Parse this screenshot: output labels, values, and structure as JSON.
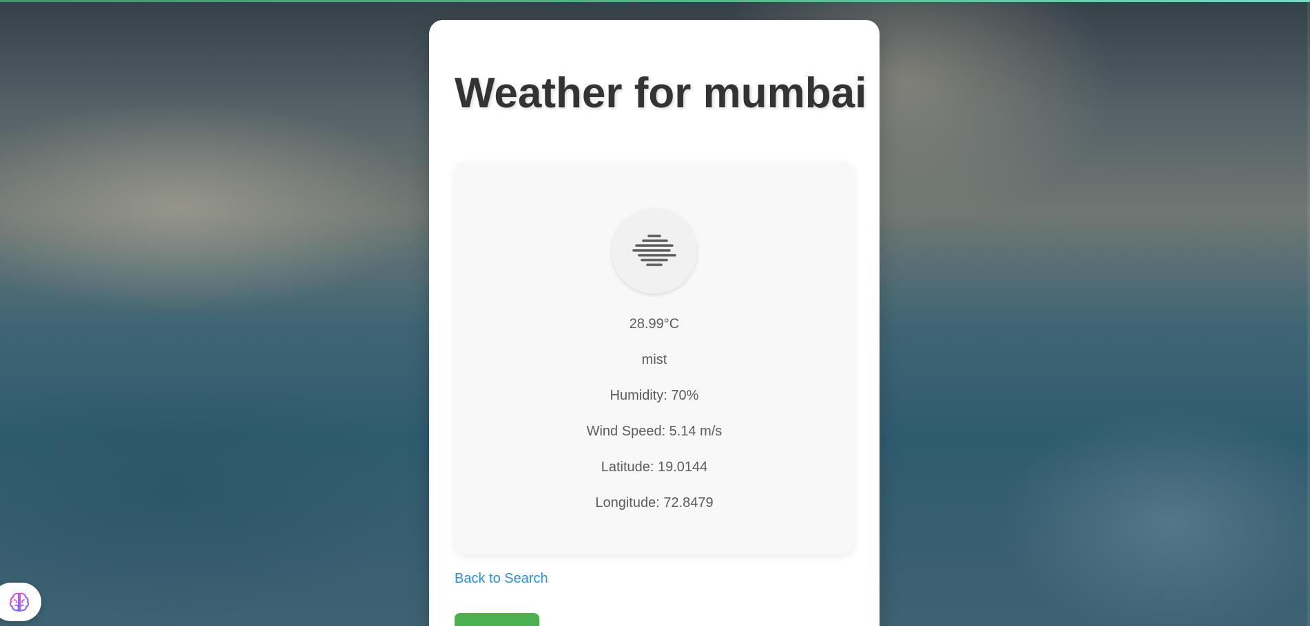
{
  "page": {
    "title": "Weather for mumbai"
  },
  "weather": {
    "icon": "mist-icon",
    "temperature": "28.99°C",
    "description": "mist",
    "humidity": "Humidity: 70%",
    "wind_speed": "Wind Speed: 5.14 m/s",
    "latitude": "Latitude: 19.0144",
    "longitude": "Longitude: 72.8479"
  },
  "links": {
    "back_to_search": "Back to Search"
  },
  "buttons": {
    "green_button_label": ""
  },
  "widgets": {
    "assistant_icon": "brain-icon"
  },
  "colors": {
    "title": "#333333",
    "link": "#2d8fdc",
    "button": "#4caf50",
    "panel": "#f8f8f8",
    "accent_bar": "#56b889"
  }
}
